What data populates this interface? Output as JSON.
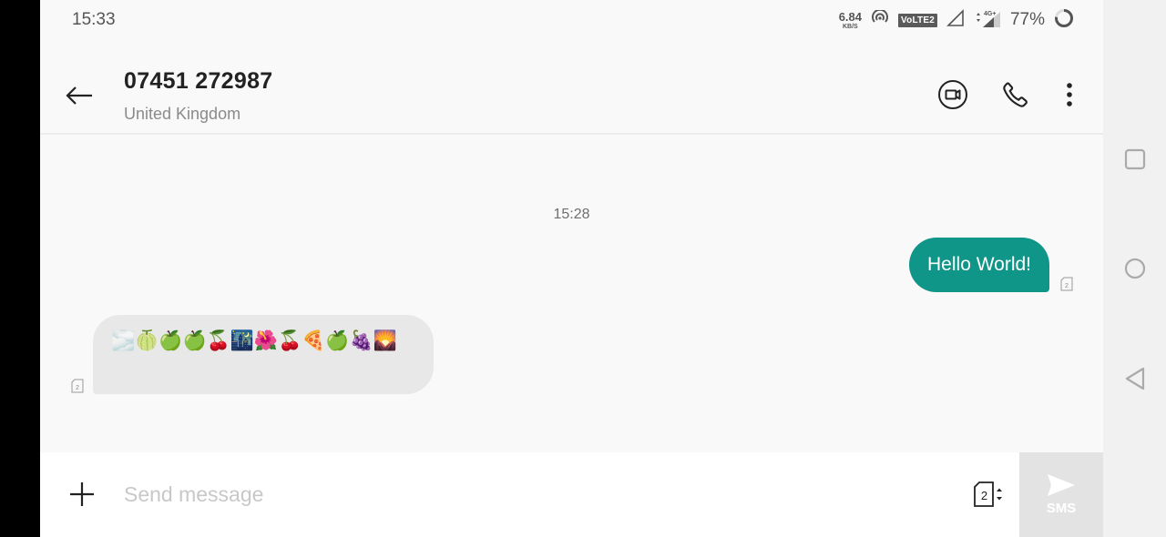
{
  "status_bar": {
    "time": "15:33",
    "net_speed_value": "6.84",
    "net_speed_unit": "KB/S",
    "volte_label": "VoLTE2",
    "network_type": "4G+",
    "battery_percent": "77%"
  },
  "header": {
    "contact_name": "07451 272987",
    "contact_subtitle": "United Kingdom",
    "icons": [
      "back-arrow-icon",
      "video-call-icon",
      "phone-icon",
      "more-vert-icon"
    ]
  },
  "conversation": {
    "timestamp": "15:28",
    "messages": [
      {
        "direction": "outgoing",
        "text": "Hello World!",
        "sim": "2"
      },
      {
        "direction": "incoming",
        "text": "🌫️🍈🍏🍏🍒🌃🌺🍒🍕🍏🍇🌄",
        "sim": "2"
      }
    ]
  },
  "composer": {
    "placeholder": "Send message",
    "value": "",
    "sim_slot": "2",
    "send_label": "SMS"
  },
  "colors": {
    "outgoing_bubble": "#0f9688",
    "incoming_bubble": "#e8e8e8",
    "send_button_disabled": "#e3e3e3"
  }
}
